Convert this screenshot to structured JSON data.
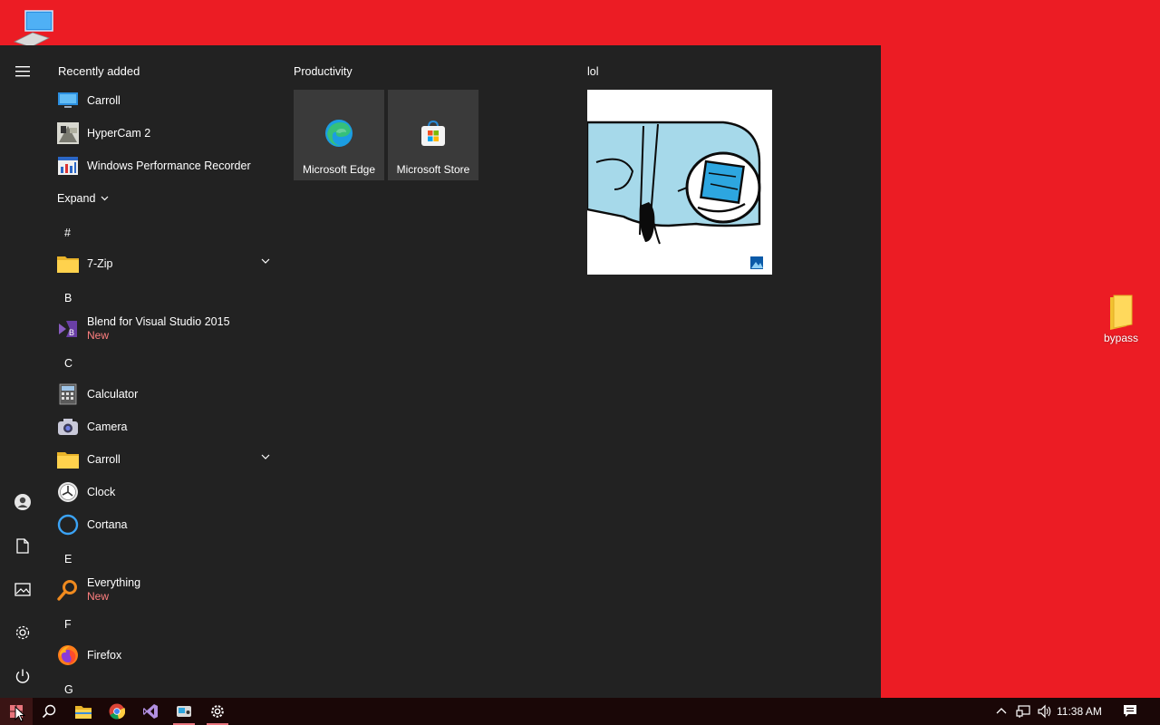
{
  "desktop": {
    "icons": [
      {
        "label": "bypass",
        "icon": "folder-icon"
      }
    ]
  },
  "start_menu": {
    "recently_added_title": "Recently added",
    "recent": [
      {
        "label": "Carroll",
        "icon": "monitor-icon"
      },
      {
        "label": "HyperCam 2",
        "icon": "hypercam-icon"
      },
      {
        "label": "Windows Performance Recorder",
        "icon": "performance-recorder-icon"
      }
    ],
    "expand_label": "Expand",
    "letters": [
      "#",
      "B",
      "C",
      "E",
      "F",
      "G"
    ],
    "apps": [
      {
        "label": "7-Zip",
        "icon": "folder-icon",
        "expandable": true
      },
      {
        "label": "Blend for Visual Studio 2015",
        "badge": "New",
        "icon": "blend-icon"
      },
      {
        "label": "Calculator",
        "icon": "calculator-icon"
      },
      {
        "label": "Camera",
        "icon": "camera-icon"
      },
      {
        "label": "Carroll",
        "icon": "folder-icon",
        "expandable": true
      },
      {
        "label": "Clock",
        "icon": "clock-icon"
      },
      {
        "label": "Cortana",
        "icon": "cortana-icon"
      },
      {
        "label": "Everything",
        "badge": "New",
        "icon": "search-icon"
      },
      {
        "label": "Firefox",
        "icon": "firefox-icon"
      }
    ],
    "groups": [
      {
        "title": "Productivity",
        "tiles": [
          {
            "label": "Microsoft Edge",
            "icon": "edge-icon"
          },
          {
            "label": "Microsoft Store",
            "icon": "store-icon"
          }
        ]
      },
      {
        "title": "lol",
        "tiles": [
          {
            "label": "",
            "icon": "photos-icon",
            "content": "drawing-image"
          }
        ]
      }
    ]
  },
  "taskbar": {
    "buttons": [
      "start-button",
      "search-button",
      "file-explorer",
      "chrome",
      "visual-studio",
      "app",
      "settings"
    ],
    "clock": "11:38 AM",
    "accent": "#ec1c24"
  }
}
